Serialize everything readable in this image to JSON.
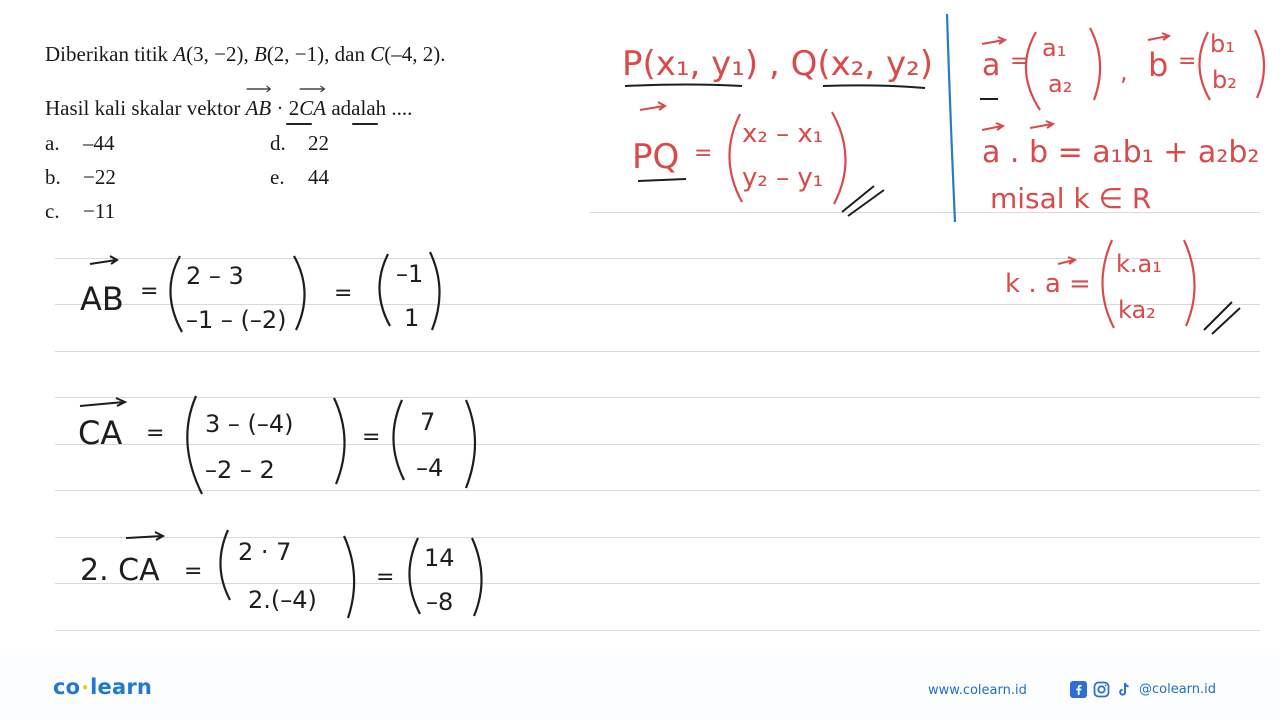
{
  "question": {
    "line1": {
      "prefix": "Diberikan titik ",
      "points": [
        {
          "name": "A",
          "coords": "(3, −2)",
          "sep": ", "
        },
        {
          "name": "B",
          "coords": "(2, −1)",
          "sep": ", dan "
        },
        {
          "name": "C",
          "coords": "(–4, 2)",
          "sep": "."
        }
      ]
    },
    "line2": {
      "prefix": "Hasil kali skalar vektor ",
      "vec1": "AB",
      "dot": " · 2",
      "vec2": "CA",
      "suffix": " adalah ...."
    },
    "options": [
      {
        "label": "a.",
        "value": "–44"
      },
      {
        "label": "b.",
        "value": "−22"
      },
      {
        "label": "c.",
        "value": "−11"
      },
      {
        "label": "d.",
        "value": "22"
      },
      {
        "label": "e.",
        "value": "44"
      }
    ]
  },
  "notes_red": {
    "points": "P(x₁, y₁) , Q(x₂, y₂)",
    "pq_lhs": "PQ",
    "pq_eq": "=",
    "pq_top": "x₂ – x₁",
    "pq_bottom": "y₂ – y₁",
    "a_lhs": "a",
    "a_top": "a₁",
    "a_bottom": "a₂",
    "b_lhs": "b",
    "b_top": "b₁",
    "b_bottom": "b₂",
    "dot_formula": "a . b = a₁b₁ + a₂b₂",
    "misal": "misal  k ∈ R",
    "k_lhs": "k . a =",
    "k_top": "k.a₁",
    "k_bottom": "ka₂"
  },
  "work_black": [
    {
      "lhs": "AB",
      "eq": "=",
      "top": "2 – 3",
      "bottom": "–1 – (–2)",
      "res_top": "–1",
      "res_bottom": "1"
    },
    {
      "lhs": "CA",
      "eq": "=",
      "top": "3 – (–4)",
      "bottom": "–2 – 2",
      "res_top": "7",
      "res_bottom": "–4"
    },
    {
      "lhs": "2. CA",
      "eq": "=",
      "top": "2 · 7",
      "bottom": "2.(–4)",
      "res_top": "14",
      "res_bottom": "–8"
    }
  ],
  "footer": {
    "brand_left": "co",
    "brand_dot": "•",
    "brand_right": "learn",
    "website": "www.colearn.id",
    "handle": "@colearn.id",
    "icons": [
      "facebook-icon",
      "instagram-icon",
      "tiktok-icon"
    ]
  },
  "colors": {
    "ink_red": "#d94a4a",
    "ink_black": "#1e1e1e",
    "ink_blue": "#2a7bc0",
    "brand_blue": "#1f78d1",
    "brand_yellow": "#f3c623"
  }
}
